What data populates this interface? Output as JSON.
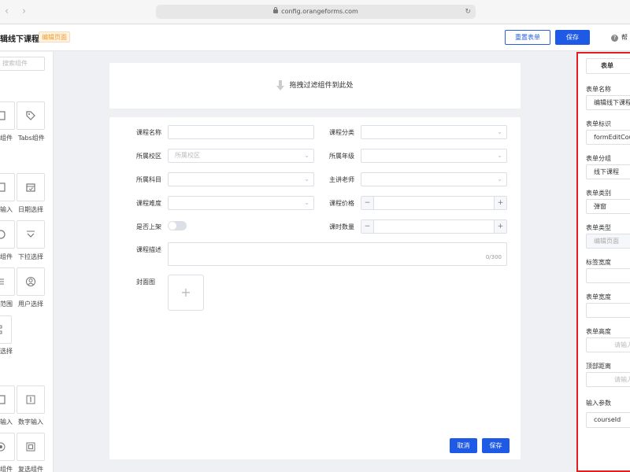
{
  "browser": {
    "url": "config.orangeforms.com"
  },
  "header": {
    "title": "辑线下课程",
    "mode_tag": "编辑页面",
    "reset_label": "重置表单",
    "save_label": "保存",
    "help_label": "帮"
  },
  "palette": {
    "search_placeholder": "搜索组件",
    "items": [
      {
        "label": "组件",
        "icon": "grid-icon"
      },
      {
        "label": "Tabs组件",
        "icon": "tag-icon"
      },
      {
        "label": "输入",
        "icon": "input-icon"
      },
      {
        "label": "日期选择",
        "icon": "calendar-icon"
      },
      {
        "label": "组件",
        "icon": "circle-icon"
      },
      {
        "label": "下拉选择",
        "icon": "dropdown-icon"
      },
      {
        "label": "范围",
        "icon": "list-icon"
      },
      {
        "label": "用户选择",
        "icon": "user-icon"
      },
      {
        "label": "选择",
        "icon": "tree-icon"
      },
      {
        "label": "输入",
        "icon": "input-icon"
      },
      {
        "label": "数字输入",
        "icon": "number-icon"
      },
      {
        "label": "组件",
        "icon": "radio-icon"
      },
      {
        "label": "复选组件",
        "icon": "checkbox-icon"
      }
    ]
  },
  "canvas": {
    "drop_hint": "拖拽过滤组件到此处",
    "fields": {
      "course_name": "课程名称",
      "course_category": "课程分类",
      "campus": "所属校区",
      "campus_placeholder": "所属校区",
      "grade": "所属年级",
      "subject": "所属科目",
      "teacher": "主讲老师",
      "difficulty": "课程难度",
      "price": "课程价格",
      "on_shelf": "是否上架",
      "lesson_count": "课时数量",
      "description": "课程描述",
      "description_counter": "0/300",
      "cover": "封面图"
    },
    "cancel_label": "取消",
    "save_label": "保存"
  },
  "props": {
    "tab_label": "表单",
    "form_name_label": "表单名称",
    "form_name_value": "编辑线下课程",
    "form_id_label": "表单标识",
    "form_id_value": "formEditCour",
    "form_group_label": "表单分组",
    "form_group_value": "线下课程",
    "form_category_label": "表单类别",
    "form_category_value": "弹窗",
    "form_type_label": "表单类型",
    "form_type_value": "编辑页面",
    "label_width_label": "标签宽度",
    "form_width_label": "表单宽度",
    "form_height_label": "表单高度",
    "form_height_placeholder": "请输入",
    "top_distance_label": "顶部距离",
    "top_distance_placeholder": "请输入",
    "params_label": "输入参数",
    "params_value": "courseId"
  },
  "colors": {
    "primary": "#1e5ae6",
    "tag": "#f59a23",
    "highlight": "#e02020"
  }
}
